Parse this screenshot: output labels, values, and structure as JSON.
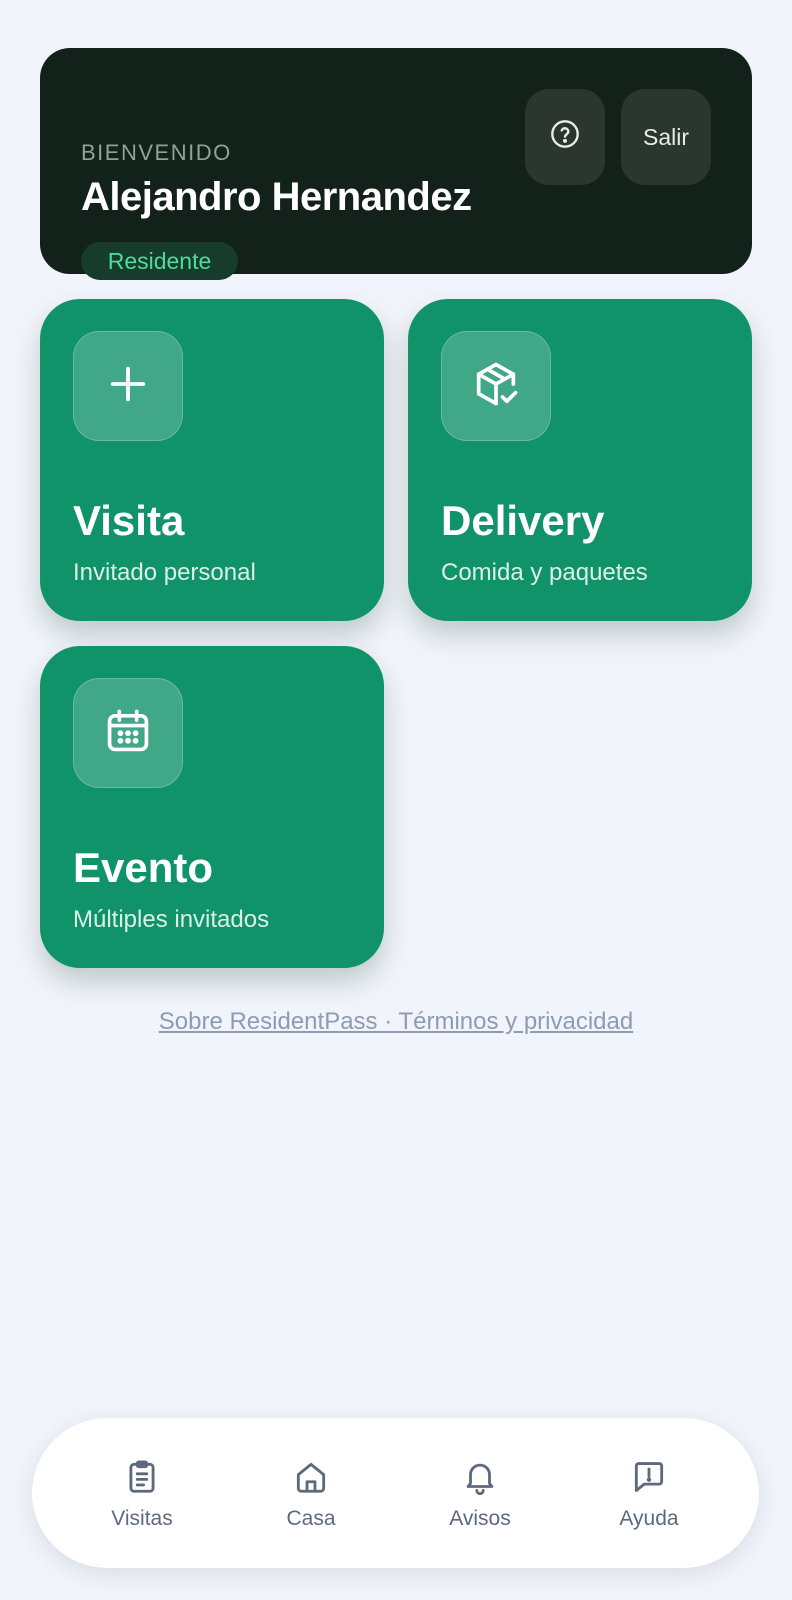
{
  "header": {
    "welcome": "BIENVENIDO",
    "user_name": "Alejandro Hernandez",
    "role": "Residente",
    "help_icon": "help-circle-icon",
    "logout_label": "Salir"
  },
  "actions": [
    {
      "title": "Visita",
      "subtitle": "Invitado personal",
      "icon": "plus-icon"
    },
    {
      "title": "Delivery",
      "subtitle": "Comida y paquetes",
      "icon": "package-check-icon"
    },
    {
      "title": "Evento",
      "subtitle": "Múltiples invitados",
      "icon": "calendar-icon"
    }
  ],
  "footer": {
    "about": "Sobre ResidentPass",
    "separator": " · ",
    "terms": "Términos y privacidad"
  },
  "nav": [
    {
      "label": "Visitas",
      "icon": "clipboard-list-icon"
    },
    {
      "label": "Casa",
      "icon": "home-icon"
    },
    {
      "label": "Avisos",
      "icon": "bell-icon"
    },
    {
      "label": "Ayuda",
      "icon": "message-alert-icon"
    }
  ],
  "colors": {
    "background": "#f1f4fa",
    "header_bg": "#13211b",
    "accent_green": "#11936a",
    "badge_text": "#4fdc9b",
    "nav_text": "#5d6a7e",
    "footer_link": "#8e9bb3"
  }
}
